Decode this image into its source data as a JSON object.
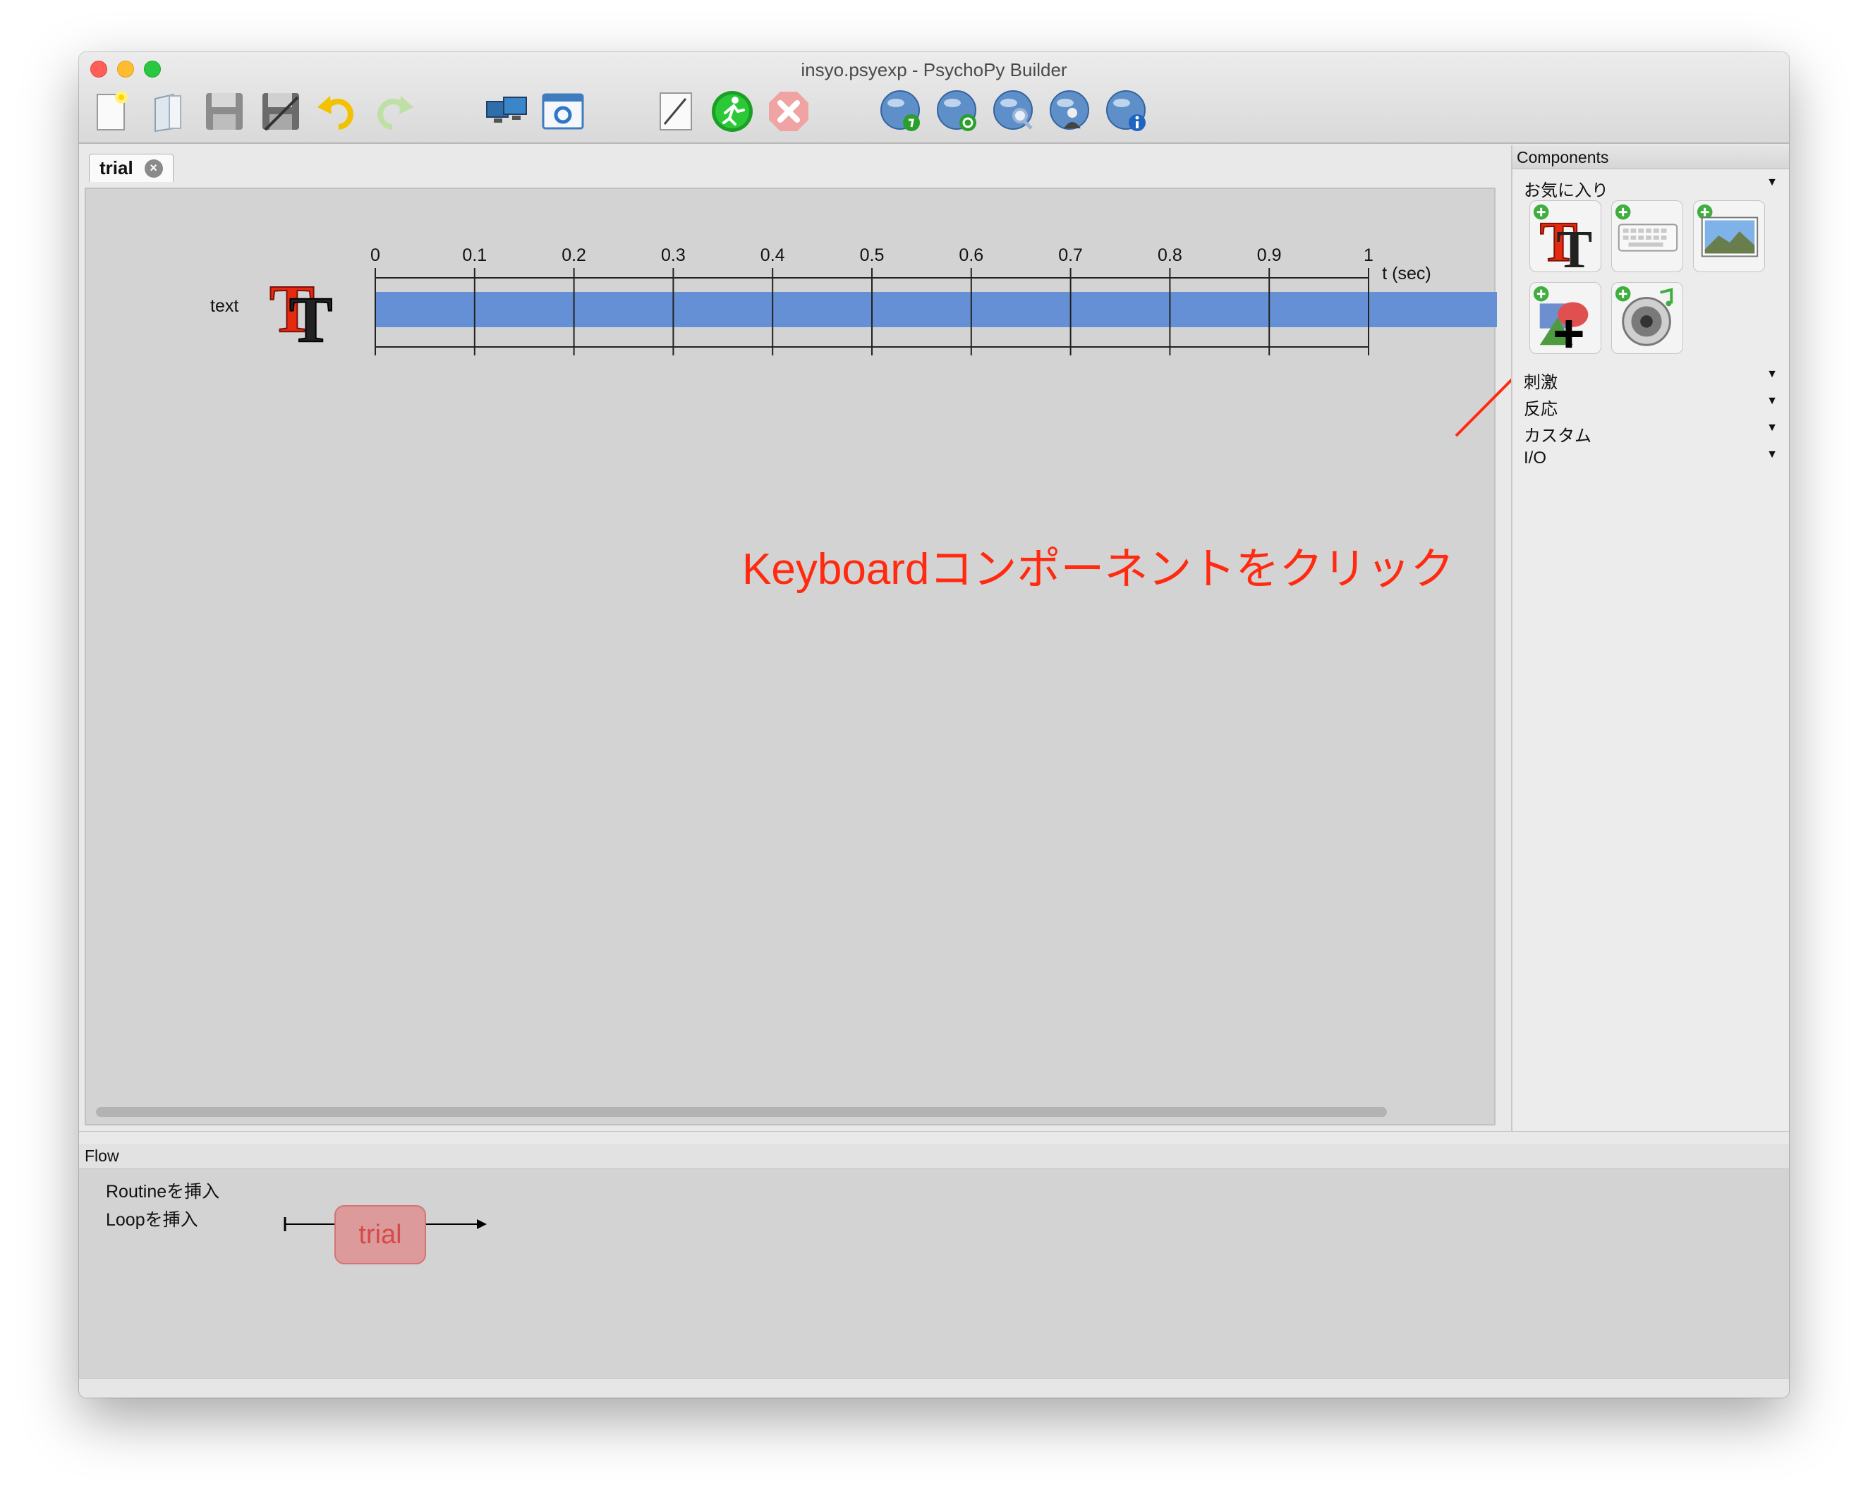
{
  "window": {
    "title": "insyo.psyexp - PsychoPy Builder"
  },
  "toolbar": {
    "tools": [
      "new-file-icon",
      "open-file-icon",
      "save-icon",
      "save-as-icon",
      "undo-icon",
      "redo-icon",
      "monitor-center-icon",
      "experiment-settings-icon",
      "compile-script-icon",
      "run-icon",
      "stop-icon",
      "pavlovia-sync-icon",
      "pavlovia-refresh-icon",
      "pavlovia-search-icon",
      "pavlovia-user-icon",
      "pavlovia-info-icon"
    ]
  },
  "routine": {
    "tab_label": "trial",
    "component_name": "text",
    "timeline": {
      "ticks": [
        "0",
        "0.1",
        "0.2",
        "0.3",
        "0.4",
        "0.5",
        "0.6",
        "0.7",
        "0.8",
        "0.9",
        "1"
      ],
      "unit_label": "t (sec)",
      "bar_color": "#6590d6"
    }
  },
  "annotation": {
    "text": "Keyboardコンポーネントをクリック",
    "color": "#ff2a10"
  },
  "components_panel": {
    "header": "Components",
    "favorites_label": "お気に入り",
    "favorites": [
      "text-component-icon",
      "keyboard-component-icon",
      "image-component-icon",
      "polygon-component-icon",
      "sound-component-icon"
    ],
    "categories": [
      "刺激",
      "反応",
      "カスタム",
      "I/O"
    ]
  },
  "flow": {
    "header": "Flow",
    "insert_routine": "Routineを挿入",
    "insert_loop": "Loopを挿入",
    "routine_label": "trial"
  }
}
